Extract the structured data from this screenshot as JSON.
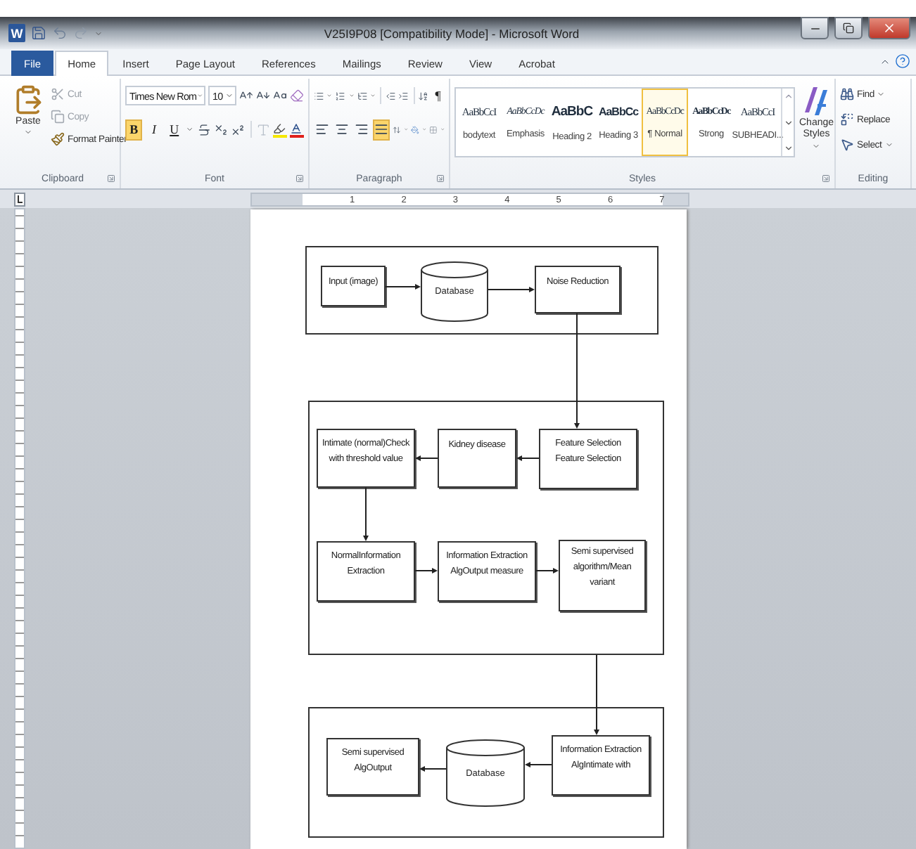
{
  "window": {
    "app_icon": "W",
    "title": "V25I9P08 [Compatibility Mode] - Microsoft Word"
  },
  "tabs": [
    {
      "label": "File",
      "kind": "file",
      "selected": false
    },
    {
      "label": "Home",
      "kind": "tab",
      "selected": true
    },
    {
      "label": "Insert",
      "kind": "tab",
      "selected": false
    },
    {
      "label": "Page Layout",
      "kind": "tab",
      "selected": false
    },
    {
      "label": "References",
      "kind": "tab",
      "selected": false
    },
    {
      "label": "Mailings",
      "kind": "tab",
      "selected": false
    },
    {
      "label": "Review",
      "kind": "tab",
      "selected": false
    },
    {
      "label": "View",
      "kind": "tab",
      "selected": false
    },
    {
      "label": "Acrobat",
      "kind": "tab",
      "selected": false
    }
  ],
  "clipboard": {
    "paste": "Paste",
    "label": "Clipboard",
    "items": [
      {
        "label": "Cut",
        "kind": "cut",
        "disabled": true
      },
      {
        "label": "Copy",
        "kind": "copy",
        "disabled": true
      },
      {
        "label": "Format Painter",
        "kind": "painter",
        "disabled": false
      }
    ]
  },
  "font": {
    "name": "Times New Rom",
    "size": "10",
    "label": "Font",
    "format_buttons": [
      {
        "label": "B",
        "kind": "bold",
        "selected": true
      },
      {
        "label": "I",
        "kind": "italic",
        "selected": false
      },
      {
        "label": "U",
        "kind": "underline",
        "selected": false
      }
    ]
  },
  "paragraph": {
    "label": "Paragraph",
    "show_marks": {
      "label": "¶",
      "selected": false
    },
    "alignments": [
      {
        "kind": "left",
        "selected": false
      },
      {
        "kind": "center",
        "selected": false
      },
      {
        "kind": "right",
        "selected": false
      },
      {
        "kind": "justify",
        "selected": true
      }
    ]
  },
  "styles": {
    "label": "Styles",
    "change_styles": "Change Styles",
    "items": [
      {
        "preview": "AaBbCcI",
        "name": "bodytext",
        "kind": "serif",
        "selected": false
      },
      {
        "preview": "AaBbCcDc",
        "name": "Emphasis",
        "kind": "italic",
        "selected": false
      },
      {
        "preview": "AaBbC",
        "name": "Heading 2",
        "kind": "heading",
        "selected": false
      },
      {
        "preview": "AaBbCc",
        "name": "Heading 3",
        "kind": "subheading",
        "selected": false
      },
      {
        "preview": "AaBbCcDc",
        "name": "¶ Normal",
        "kind": "plain",
        "selected": true
      },
      {
        "preview": "AaBbCcDc",
        "name": "Strong",
        "kind": "strong",
        "selected": false
      },
      {
        "preview": "AaBbCcI",
        "name": "SUBHEADI...",
        "kind": "serif",
        "selected": false
      }
    ]
  },
  "editing": {
    "label": "Editing",
    "items": [
      {
        "label": "Find",
        "kind": "find"
      },
      {
        "label": "Replace",
        "kind": "replace"
      },
      {
        "label": "Select",
        "kind": "select"
      }
    ]
  },
  "ruler": {
    "numbers": [
      "1",
      "2",
      "3",
      "4",
      "5",
      "6",
      "7"
    ]
  },
  "diagram": {
    "frames": [
      {
        "nodes": [
          {
            "kind": "process",
            "lines": [
              "Input (image)"
            ]
          },
          {
            "kind": "database",
            "lines": [
              "Database"
            ]
          },
          {
            "kind": "process",
            "lines": [
              "Noise Reduction"
            ]
          }
        ]
      },
      {
        "nodes": [
          {
            "kind": "process",
            "lines": [
              "Intimate (normal)Check",
              "with threshold value"
            ]
          },
          {
            "kind": "process",
            "lines": [
              "Kidney disease"
            ]
          },
          {
            "kind": "process",
            "lines": [
              "Feature Selection",
              "Feature Selection"
            ]
          },
          {
            "kind": "process",
            "lines": [
              "NormalInformation",
              "Extraction"
            ]
          },
          {
            "kind": "process",
            "lines": [
              "Information Extraction",
              "AlgOutput measure"
            ]
          },
          {
            "kind": "process",
            "lines": [
              "Semi supervised",
              "algorithm/Mean",
              "variant"
            ]
          }
        ]
      },
      {
        "nodes": [
          {
            "kind": "process",
            "lines": [
              "Semi supervised",
              "AlgOutput"
            ]
          },
          {
            "kind": "database",
            "lines": [
              "Database"
            ]
          },
          {
            "kind": "process",
            "lines": [
              "Information Extraction",
              "AlgIntimate with"
            ]
          }
        ]
      }
    ]
  }
}
